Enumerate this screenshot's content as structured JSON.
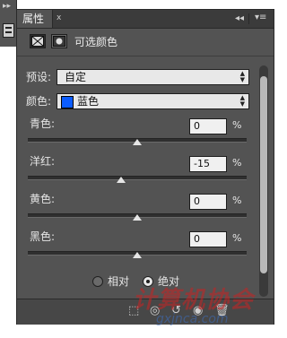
{
  "panel": {
    "tab_label": "属性",
    "tab_close": "x",
    "collapse_icon": "◂◂",
    "menu_icon": "▾≡",
    "title": "可选颜色"
  },
  "preset": {
    "label": "预设:",
    "value": "自定"
  },
  "colors": {
    "label": "颜色:",
    "value": "蓝色",
    "swatch_color": "#0b5cff"
  },
  "sliders": [
    {
      "label": "青色:",
      "value": "0",
      "unit": "%",
      "level_percent": 0
    },
    {
      "label": "洋红:",
      "value": "-15",
      "unit": "%",
      "level_percent": -15
    },
    {
      "label": "黄色:",
      "value": "0",
      "unit": "%",
      "level_percent": 0
    },
    {
      "label": "黑色:",
      "value": "0",
      "unit": "%",
      "level_percent": 0
    }
  ],
  "method": {
    "relative_label": "相对",
    "absolute_label": "绝对",
    "selected": "absolute"
  },
  "watermark": {
    "text": "计算机协会",
    "sub": "gxjnca.com"
  }
}
